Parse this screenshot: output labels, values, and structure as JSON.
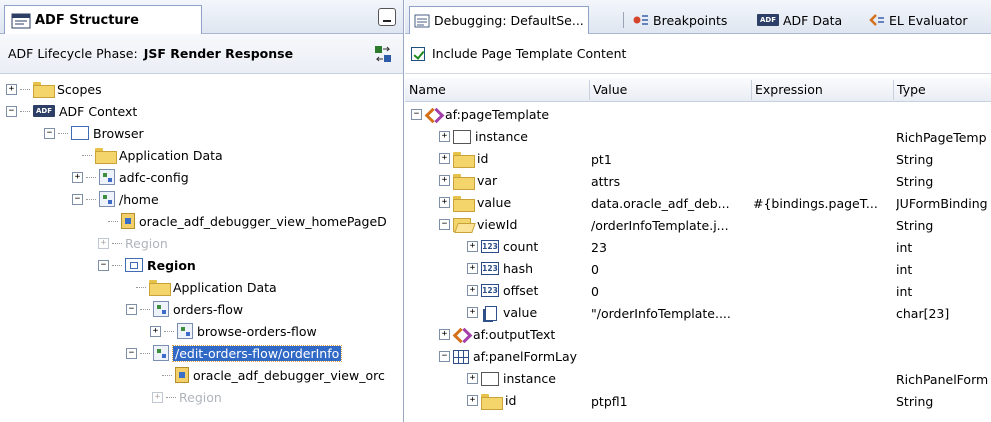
{
  "left_panel": {
    "tab_title": "ADF Structure",
    "phase_label": "ADF Lifecycle Phase:",
    "phase_value": "JSF Render Response",
    "tree": [
      {
        "label": "Scopes"
      },
      {
        "label": "ADF Context"
      },
      {
        "label": "Browser"
      },
      {
        "label": "Application Data"
      },
      {
        "label": "adfc-config"
      },
      {
        "label": "/home"
      },
      {
        "label": "oracle_adf_debugger_view_homePageD"
      },
      {
        "label": "Region"
      },
      {
        "label": "Region"
      },
      {
        "label": "Application Data"
      },
      {
        "label": "orders-flow"
      },
      {
        "label": "browse-orders-flow"
      },
      {
        "label": "/edit-orders-flow/orderInfo"
      },
      {
        "label": "oracle_adf_debugger_view_orc"
      },
      {
        "label": "Region"
      }
    ]
  },
  "right_panel": {
    "tabs": [
      {
        "label": "Debugging: DefaultSe..."
      },
      {
        "label": "Breakpoints"
      },
      {
        "label": "ADF Data"
      },
      {
        "label": "EL Evaluator"
      }
    ],
    "include_label": "Include Page Template Content",
    "columns": {
      "name": "Name",
      "value": "Value",
      "expression": "Expression",
      "type": "Type"
    },
    "rows": [
      {
        "name": "af:pageTemplate",
        "value": "",
        "expression": "",
        "type": ""
      },
      {
        "name": "instance",
        "value": "",
        "expression": "",
        "type": "RichPageTemp"
      },
      {
        "name": "id",
        "value": "pt1",
        "expression": "",
        "type": "String"
      },
      {
        "name": "var",
        "value": "attrs",
        "expression": "",
        "type": "String"
      },
      {
        "name": "value",
        "value": "data.oracle_adf_deb...",
        "expression": "#{bindings.pageT...",
        "type": "JUFormBinding"
      },
      {
        "name": "viewId",
        "value": "/orderInfoTemplate.j...",
        "expression": "",
        "type": "String"
      },
      {
        "name": "count",
        "value": "23",
        "expression": "",
        "type": "int"
      },
      {
        "name": "hash",
        "value": "0",
        "expression": "",
        "type": "int"
      },
      {
        "name": "offset",
        "value": "0",
        "expression": "",
        "type": "int"
      },
      {
        "name": "value",
        "value": "\"/orderInfoTemplate....",
        "expression": "",
        "type": "char[23]"
      },
      {
        "name": "af:outputText",
        "value": "",
        "expression": "",
        "type": ""
      },
      {
        "name": "af:panelFormLay",
        "value": "",
        "expression": "",
        "type": ""
      },
      {
        "name": "instance",
        "value": "",
        "expression": "",
        "type": "RichPanelForm"
      },
      {
        "name": "id",
        "value": "ptpfl1",
        "expression": "",
        "type": "String"
      }
    ]
  }
}
